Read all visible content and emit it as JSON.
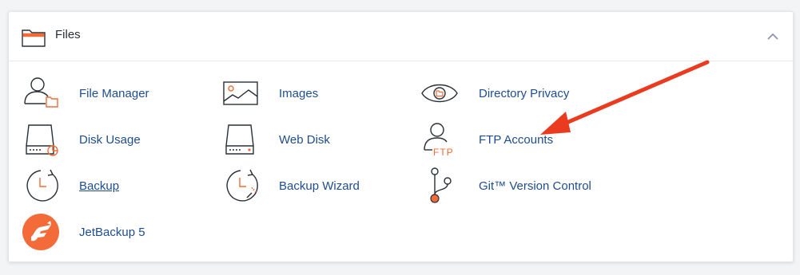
{
  "panel": {
    "title": "Files",
    "header_icon": "folder-icon",
    "toggle_icon": "chevron-up-icon"
  },
  "items": [
    {
      "label": "File Manager",
      "icon": "file-manager-icon"
    },
    {
      "label": "Images",
      "icon": "image-icon"
    },
    {
      "label": "Directory Privacy",
      "icon": "eye-folder-icon"
    },
    {
      "label": "Disk Usage",
      "icon": "disk-usage-icon"
    },
    {
      "label": "Web Disk",
      "icon": "web-disk-icon"
    },
    {
      "label": "FTP Accounts",
      "icon": "ftp-user-icon",
      "badge": "FTP"
    },
    {
      "label": "Backup",
      "icon": "backup-clock-icon"
    },
    {
      "label": "Backup Wizard",
      "icon": "backup-wizard-icon"
    },
    {
      "label": "Git™ Version Control",
      "icon": "git-branch-icon"
    },
    {
      "label": "JetBackup 5",
      "icon": "jetbackup-logo-icon"
    }
  ],
  "colors": {
    "accent_orange": "#f26b38",
    "link_blue": "#1f4d8c",
    "icon_dark": "#2a2f36",
    "annotation_arrow": "#ea3a1f"
  }
}
